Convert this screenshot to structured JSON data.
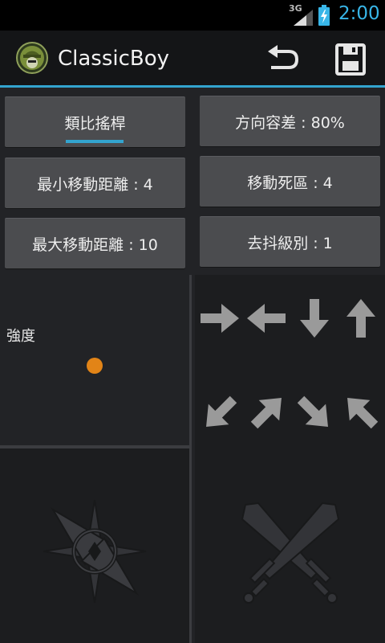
{
  "status_bar": {
    "network": "3G",
    "time": "2:00"
  },
  "action_bar": {
    "title": "ClassicBoy",
    "icons": [
      "app-logo-icon",
      "undo-icon",
      "save-icon"
    ]
  },
  "settings": {
    "active_tab": "類比搖桿",
    "direction_tolerance": "方向容差 : 80%",
    "min_move_distance": "最小移動距離 : 4",
    "move_deadzone": "移動死區 : 4",
    "max_move_distance": "最大移動距離 : 10",
    "debounce_level": "去抖級別 : 1"
  },
  "strength": {
    "label": "強度"
  },
  "direction_arrows": [
    "right",
    "left",
    "down",
    "up",
    "down-left",
    "up-right",
    "down-right",
    "up-left"
  ],
  "colors": {
    "accent": "#33a4cf",
    "clock": "#38b6e8",
    "indicator_dot": "#e28417"
  }
}
